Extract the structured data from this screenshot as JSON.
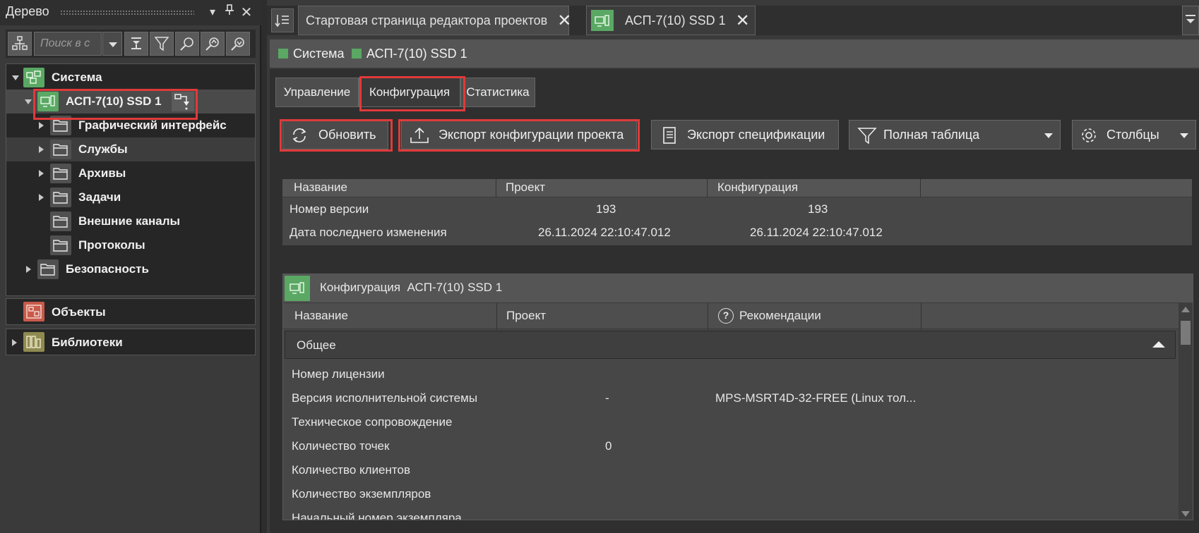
{
  "tree_panel": {
    "title": "Дерево",
    "search_placeholder": "Поиск в с",
    "items": [
      {
        "label": "Система"
      },
      {
        "label": "АСП-7(10) SSD 1"
      },
      {
        "label": "Графический интерфейс"
      },
      {
        "label": "Службы"
      },
      {
        "label": "Архивы"
      },
      {
        "label": "Задачи"
      },
      {
        "label": "Внешние каналы"
      },
      {
        "label": "Протоколы"
      },
      {
        "label": "Безопасность"
      }
    ],
    "sections": [
      {
        "label": "Объекты"
      },
      {
        "label": "Библиотеки"
      }
    ]
  },
  "doc_tabs": [
    {
      "label": "Стартовая страница редактора проектов"
    },
    {
      "label": "АСП-7(10) SSD 1"
    }
  ],
  "breadcrumb": [
    {
      "label": "Система"
    },
    {
      "label": "АСП-7(10) SSD 1"
    }
  ],
  "sub_tabs": [
    {
      "label": "Управление"
    },
    {
      "label": "Конфигурация"
    },
    {
      "label": "Статистика"
    }
  ],
  "actions": {
    "refresh": "Обновить",
    "export_config": "Экспорт конфигурации проекта",
    "export_spec": "Экспорт спецификации",
    "filter": "Полная таблица",
    "columns": "Столбцы"
  },
  "version_table": {
    "headers": [
      "Название",
      "Проект",
      "Конфигурация"
    ],
    "rows": [
      [
        "Номер версии",
        "193",
        "193"
      ],
      [
        "Дата последнего изменения",
        "26.11.2024 22:10:47.012",
        "26.11.2024 22:10:47.012"
      ]
    ]
  },
  "config_panel": {
    "title": "Конфигурация  АСП-7(10) SSD 1",
    "headers": [
      "Название",
      "Проект",
      "Рекомендации"
    ],
    "group": "Общее",
    "rows": [
      [
        "Номер лицензии",
        "",
        ""
      ],
      [
        "Версия исполнительной системы",
        "-",
        "MPS-MSRT4D-32-FREE (Linux тол..."
      ],
      [
        "Техническое сопровождение",
        "",
        ""
      ],
      [
        "Количество точек",
        "0",
        ""
      ],
      [
        "Количество клиентов",
        "",
        ""
      ],
      [
        "Количество экземпляров",
        "",
        ""
      ],
      [
        "Начальный номер экземпляра",
        "",
        ""
      ]
    ]
  },
  "colors": {
    "accent_green": "#5aa864",
    "highlight_red": "#e03a3a",
    "objects_icon": "#c85a4a",
    "library_icon": "#8f8a50"
  }
}
